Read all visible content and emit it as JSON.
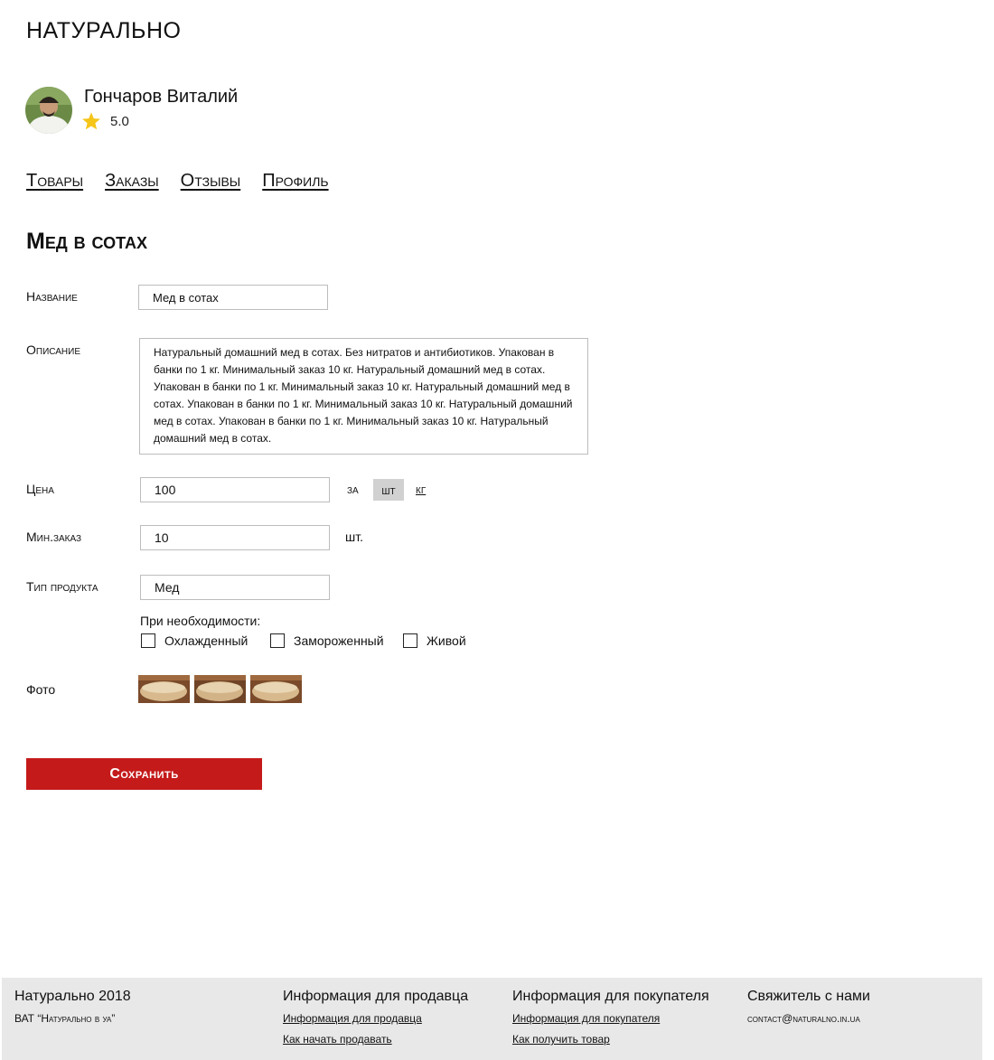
{
  "brand": "НАТУРАЛЬНО",
  "seller": {
    "name": "Гончаров Виталий",
    "rating": "5.0"
  },
  "nav": {
    "items": [
      "Товары",
      "Заказы",
      "Отзывы",
      "Профиль"
    ]
  },
  "page": {
    "title": "Мед в сотах"
  },
  "form": {
    "name_label": "Название",
    "name_value": "Мед в сотах",
    "description_label": "Описание",
    "description_value": "Натуральный домашний мед в сотах. Без нитратов и антибиотиков. Упакован в банки по 1 кг. Минимальный заказ 10 кг. Натуральный домашний мед в сотах. Упакован в банки по 1 кг. Минимальный заказ 10 кг. Натуральный домашний мед в сотах. Упакован в банки по 1 кг. Минимальный заказ 10 кг. Натуральный домашний мед в сотах. Упакован в банки по 1 кг. Минимальный заказ 10 кг. Натуральный домашний мед в сотах.",
    "price_label": "Цена",
    "price_value": "100",
    "price_per": "за",
    "unit_options": [
      "шт",
      "кг"
    ],
    "unit_selected": "шт",
    "min_order_label": "Мин.заказ",
    "min_order_value": "10",
    "min_order_unit": "шт.",
    "type_label": "Тип продукта",
    "type_value": "Мед",
    "needs_label": "При необходимости:",
    "checkboxes": [
      {
        "label": "Охлажденный",
        "checked": false
      },
      {
        "label": "Замороженный",
        "checked": false
      },
      {
        "label": "Живой",
        "checked": false
      }
    ],
    "photo_label": "Фото",
    "photo_count": 3,
    "save_label": "Сохранить"
  },
  "footer": {
    "col1": {
      "title": "Натурально 2018",
      "sub": "ВАТ “Натурально в уа”"
    },
    "col2": {
      "title": "Информация для продавца",
      "links": [
        "Информация для продавца",
        "Как начать продавать"
      ]
    },
    "col3": {
      "title": "Информация для покупателя",
      "links": [
        "Информация для покупателя",
        "Как получить товар"
      ]
    },
    "col4": {
      "title": "Свяжитель с нами",
      "email": "contact@naturalno.in.ua"
    }
  },
  "colors": {
    "accent": "#c41a1a",
    "star": "#f5c518",
    "footer_bg": "#e8e8e8",
    "selected_unit_bg": "#d1d1d1"
  }
}
